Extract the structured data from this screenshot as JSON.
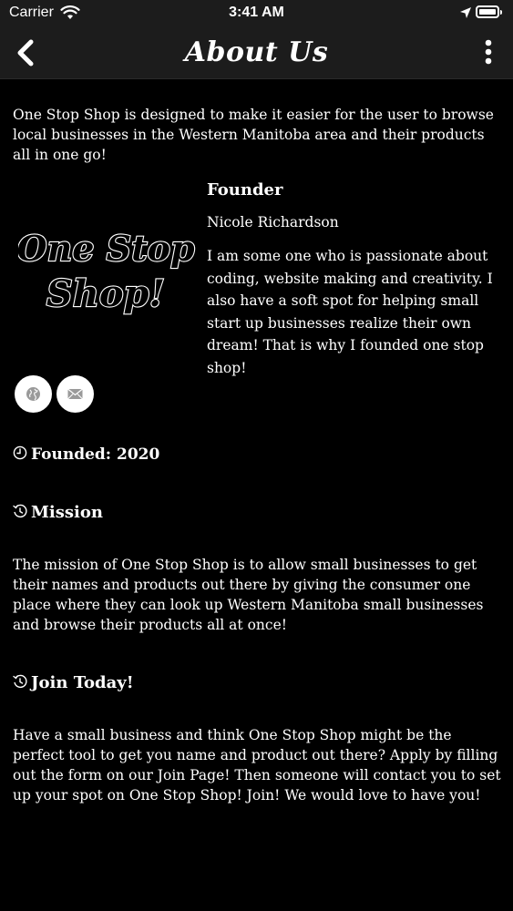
{
  "status_bar": {
    "carrier": "Carrier",
    "time": "3:41 AM"
  },
  "nav": {
    "title": "About Us",
    "back_icon": "chevron-left-icon",
    "menu_icon": "more-vertical-icon"
  },
  "intro": "One Stop Shop is designed to make it easier for the user to browse local businesses in the Western Manitoba area and their products all in one go!",
  "logo": {
    "line1": "One Stop",
    "line2": "Shop!"
  },
  "founder": {
    "heading": "Founder",
    "name": "Nicole Richardson",
    "bio": "I am some one who is passionate about coding, website making and creativity. I also have a soft spot for helping small start up businesses realize their own dream! That is why I founded one stop shop!"
  },
  "contact_buttons": {
    "web_icon": "globe-icon",
    "email_icon": "envelope-icon"
  },
  "founded": {
    "label": "Founded:",
    "year": "2020"
  },
  "mission": {
    "heading": "Mission",
    "text": "The mission of One Stop Shop is to allow small businesses to get their names and products out there by giving the consumer one place where they can look up Western Manitoba small businesses and browse their products all at once!"
  },
  "join": {
    "heading": "Join Today!",
    "text": "Have a small business and think One Stop Shop might be the perfect tool to get you name and product out there? Apply by filling out the form on our Join Page! Then someone will contact you to set up your spot on One Stop Shop! Join! We would love to have you!"
  },
  "colors": {
    "background": "#000000",
    "bar": "#1c1c1c",
    "text": "#ffffff",
    "button_bg": "#ffffff",
    "icon_gray": "#9a9a9a"
  }
}
